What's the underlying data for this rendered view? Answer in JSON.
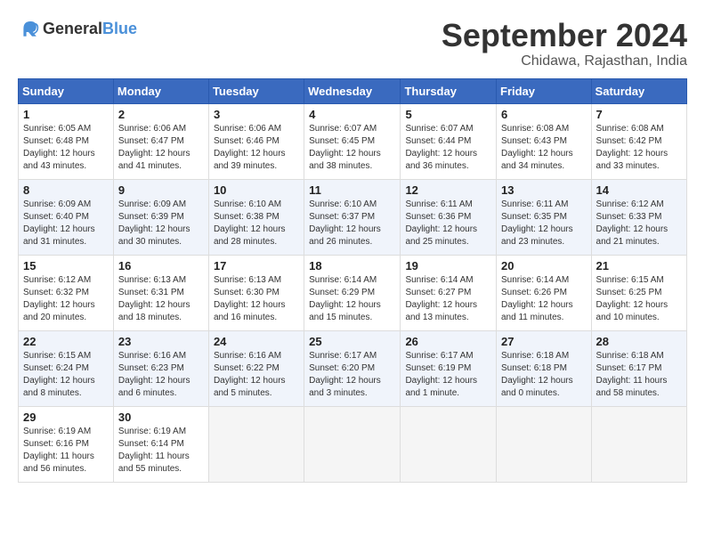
{
  "logo": {
    "text_general": "General",
    "text_blue": "Blue"
  },
  "header": {
    "month": "September 2024",
    "location": "Chidawa, Rajasthan, India"
  },
  "weekdays": [
    "Sunday",
    "Monday",
    "Tuesday",
    "Wednesday",
    "Thursday",
    "Friday",
    "Saturday"
  ],
  "weeks": [
    [
      {
        "day": "1",
        "info": "Sunrise: 6:05 AM\nSunset: 6:48 PM\nDaylight: 12 hours\nand 43 minutes."
      },
      {
        "day": "2",
        "info": "Sunrise: 6:06 AM\nSunset: 6:47 PM\nDaylight: 12 hours\nand 41 minutes."
      },
      {
        "day": "3",
        "info": "Sunrise: 6:06 AM\nSunset: 6:46 PM\nDaylight: 12 hours\nand 39 minutes."
      },
      {
        "day": "4",
        "info": "Sunrise: 6:07 AM\nSunset: 6:45 PM\nDaylight: 12 hours\nand 38 minutes."
      },
      {
        "day": "5",
        "info": "Sunrise: 6:07 AM\nSunset: 6:44 PM\nDaylight: 12 hours\nand 36 minutes."
      },
      {
        "day": "6",
        "info": "Sunrise: 6:08 AM\nSunset: 6:43 PM\nDaylight: 12 hours\nand 34 minutes."
      },
      {
        "day": "7",
        "info": "Sunrise: 6:08 AM\nSunset: 6:42 PM\nDaylight: 12 hours\nand 33 minutes."
      }
    ],
    [
      {
        "day": "8",
        "info": "Sunrise: 6:09 AM\nSunset: 6:40 PM\nDaylight: 12 hours\nand 31 minutes."
      },
      {
        "day": "9",
        "info": "Sunrise: 6:09 AM\nSunset: 6:39 PM\nDaylight: 12 hours\nand 30 minutes."
      },
      {
        "day": "10",
        "info": "Sunrise: 6:10 AM\nSunset: 6:38 PM\nDaylight: 12 hours\nand 28 minutes."
      },
      {
        "day": "11",
        "info": "Sunrise: 6:10 AM\nSunset: 6:37 PM\nDaylight: 12 hours\nand 26 minutes."
      },
      {
        "day": "12",
        "info": "Sunrise: 6:11 AM\nSunset: 6:36 PM\nDaylight: 12 hours\nand 25 minutes."
      },
      {
        "day": "13",
        "info": "Sunrise: 6:11 AM\nSunset: 6:35 PM\nDaylight: 12 hours\nand 23 minutes."
      },
      {
        "day": "14",
        "info": "Sunrise: 6:12 AM\nSunset: 6:33 PM\nDaylight: 12 hours\nand 21 minutes."
      }
    ],
    [
      {
        "day": "15",
        "info": "Sunrise: 6:12 AM\nSunset: 6:32 PM\nDaylight: 12 hours\nand 20 minutes."
      },
      {
        "day": "16",
        "info": "Sunrise: 6:13 AM\nSunset: 6:31 PM\nDaylight: 12 hours\nand 18 minutes."
      },
      {
        "day": "17",
        "info": "Sunrise: 6:13 AM\nSunset: 6:30 PM\nDaylight: 12 hours\nand 16 minutes."
      },
      {
        "day": "18",
        "info": "Sunrise: 6:14 AM\nSunset: 6:29 PM\nDaylight: 12 hours\nand 15 minutes."
      },
      {
        "day": "19",
        "info": "Sunrise: 6:14 AM\nSunset: 6:27 PM\nDaylight: 12 hours\nand 13 minutes."
      },
      {
        "day": "20",
        "info": "Sunrise: 6:14 AM\nSunset: 6:26 PM\nDaylight: 12 hours\nand 11 minutes."
      },
      {
        "day": "21",
        "info": "Sunrise: 6:15 AM\nSunset: 6:25 PM\nDaylight: 12 hours\nand 10 minutes."
      }
    ],
    [
      {
        "day": "22",
        "info": "Sunrise: 6:15 AM\nSunset: 6:24 PM\nDaylight: 12 hours\nand 8 minutes."
      },
      {
        "day": "23",
        "info": "Sunrise: 6:16 AM\nSunset: 6:23 PM\nDaylight: 12 hours\nand 6 minutes."
      },
      {
        "day": "24",
        "info": "Sunrise: 6:16 AM\nSunset: 6:22 PM\nDaylight: 12 hours\nand 5 minutes."
      },
      {
        "day": "25",
        "info": "Sunrise: 6:17 AM\nSunset: 6:20 PM\nDaylight: 12 hours\nand 3 minutes."
      },
      {
        "day": "26",
        "info": "Sunrise: 6:17 AM\nSunset: 6:19 PM\nDaylight: 12 hours\nand 1 minute."
      },
      {
        "day": "27",
        "info": "Sunrise: 6:18 AM\nSunset: 6:18 PM\nDaylight: 12 hours\nand 0 minutes."
      },
      {
        "day": "28",
        "info": "Sunrise: 6:18 AM\nSunset: 6:17 PM\nDaylight: 11 hours\nand 58 minutes."
      }
    ],
    [
      {
        "day": "29",
        "info": "Sunrise: 6:19 AM\nSunset: 6:16 PM\nDaylight: 11 hours\nand 56 minutes."
      },
      {
        "day": "30",
        "info": "Sunrise: 6:19 AM\nSunset: 6:14 PM\nDaylight: 11 hours\nand 55 minutes."
      },
      {
        "day": "",
        "info": ""
      },
      {
        "day": "",
        "info": ""
      },
      {
        "day": "",
        "info": ""
      },
      {
        "day": "",
        "info": ""
      },
      {
        "day": "",
        "info": ""
      }
    ]
  ]
}
